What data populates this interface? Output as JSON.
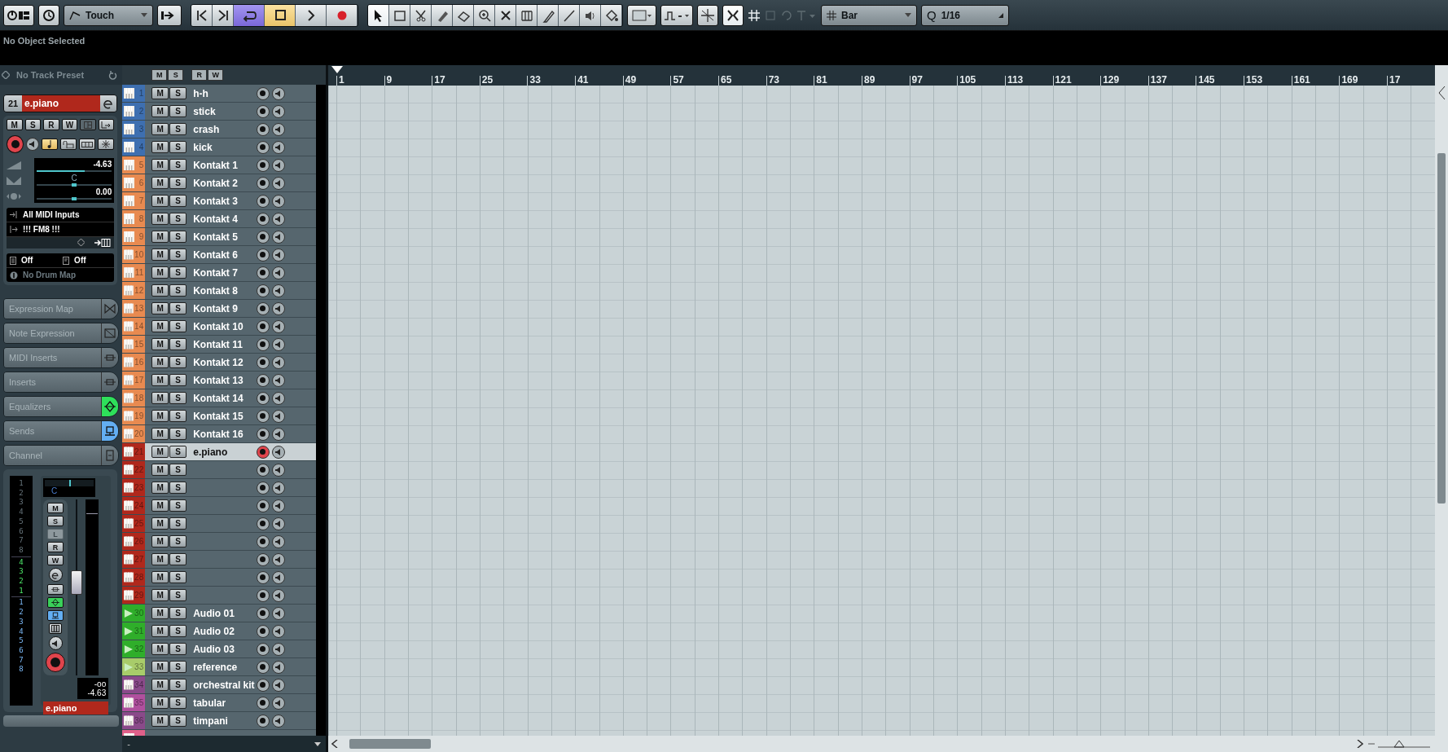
{
  "toolbar": {
    "automation_mode": "Touch",
    "transport": [
      {
        "kind": "to-start",
        "on": false
      },
      {
        "kind": "to-end",
        "on": false
      },
      {
        "kind": "cycle",
        "on": true
      },
      {
        "kind": "stop",
        "on": true
      },
      {
        "kind": "play",
        "on": false
      },
      {
        "kind": "record",
        "on": false
      }
    ],
    "tools": [
      {
        "kind": "pointer",
        "selected": true
      },
      {
        "kind": "range",
        "selected": false
      },
      {
        "kind": "split",
        "selected": false
      },
      {
        "kind": "glue",
        "selected": false
      },
      {
        "kind": "erase",
        "selected": false
      },
      {
        "kind": "zoom",
        "selected": false
      },
      {
        "kind": "mute",
        "selected": false
      },
      {
        "kind": "warp",
        "selected": false
      },
      {
        "kind": "draw",
        "selected": false
      },
      {
        "kind": "line",
        "selected": false
      },
      {
        "kind": "play",
        "selected": false
      },
      {
        "kind": "color",
        "selected": false
      }
    ],
    "snap_on": true,
    "snap_type": "Bar",
    "quantize_icon": "Q",
    "quantize": "1/16"
  },
  "info_line": "No Object Selected",
  "inspector": {
    "preset": "No Track Preset",
    "track_number": "21",
    "track_name": "e.piano",
    "buttons": [
      "M",
      "S",
      "R",
      "W"
    ],
    "record": true,
    "note_edit": true,
    "volume": {
      "reading": "-4.63",
      "level": 0.64
    },
    "pan": {
      "reading": "C",
      "level": 0.5
    },
    "delay": {
      "reading": "0.00",
      "level": 0.5
    },
    "input": "All MIDI Inputs",
    "output": "!!! FM8 !!!",
    "bank": "Off",
    "program": "Off",
    "drum_map": "No Drum Map",
    "sections": [
      {
        "label": "Expression Map",
        "kind": "expression",
        "on": false
      },
      {
        "label": "Note Expression",
        "kind": "note-expression",
        "on": false
      },
      {
        "label": "MIDI Inserts",
        "kind": "insert",
        "on": false
      },
      {
        "label": "Inserts",
        "kind": "insert",
        "on": false
      },
      {
        "label": "Equalizers",
        "kind": "eq",
        "on": true
      },
      {
        "label": "Sends",
        "kind": "send",
        "on": true
      },
      {
        "label": "Channel",
        "kind": "channel",
        "on": false
      }
    ],
    "channel": {
      "meter_scale": [
        {
          "kind": "unused",
          "labels": [
            "1",
            "2",
            "3",
            "4",
            "5",
            "6",
            "7",
            "8"
          ]
        },
        {
          "kind": "input",
          "labels": [
            "4",
            "3",
            "2",
            "1"
          ]
        },
        {
          "kind": "output",
          "labels": [
            "1",
            "2",
            "3",
            "4",
            "5",
            "6",
            "7",
            "8"
          ]
        }
      ],
      "pan": {
        "reading": "C",
        "level": 0.5
      },
      "buttons": [
        {
          "label": "M",
          "disabled": false
        },
        {
          "label": "S",
          "disabled": false
        },
        {
          "label": "L",
          "disabled": true
        },
        {
          "label": "R",
          "disabled": false
        },
        {
          "label": "W",
          "disabled": false
        }
      ],
      "icon_buttons": [
        {
          "kind": "edit",
          "on": false
        },
        {
          "kind": "insert",
          "on": false
        },
        {
          "kind": "eq",
          "on": true
        },
        {
          "kind": "send",
          "on": true
        },
        {
          "kind": "keyboard",
          "on": false
        },
        {
          "kind": "monitor",
          "on": false
        },
        {
          "kind": "record",
          "on": true
        }
      ],
      "fader": {
        "level": 0.55
      },
      "peak": "-oo",
      "volume": "-4.63",
      "name": "e.piano"
    }
  },
  "track_header_buttons": [
    "M",
    "S",
    "R",
    "W"
  ],
  "tracks": [
    {
      "number": "1",
      "name": "h-h",
      "kind": "midi",
      "color": "#3e6fb0",
      "m": "M",
      "s": "S",
      "selected": false,
      "record": false
    },
    {
      "number": "2",
      "name": "stick",
      "kind": "midi",
      "color": "#3e6fb0",
      "m": "M",
      "s": "S",
      "selected": false,
      "record": false
    },
    {
      "number": "3",
      "name": "crash",
      "kind": "midi",
      "color": "#3e6fb0",
      "m": "M",
      "s": "S",
      "selected": false,
      "record": false
    },
    {
      "number": "4",
      "name": "kick",
      "kind": "midi",
      "color": "#3e6fb0",
      "m": "M",
      "s": "S",
      "selected": false,
      "record": false
    },
    {
      "number": "5",
      "name": "Kontakt 1",
      "kind": "midi",
      "color": "#e88a50",
      "m": "M",
      "s": "S",
      "selected": false,
      "record": false
    },
    {
      "number": "6",
      "name": "Kontakt 2",
      "kind": "midi",
      "color": "#e88a50",
      "m": "M",
      "s": "S",
      "selected": false,
      "record": false
    },
    {
      "number": "7",
      "name": "Kontakt 3",
      "kind": "midi",
      "color": "#e88a50",
      "m": "M",
      "s": "S",
      "selected": false,
      "record": false
    },
    {
      "number": "8",
      "name": "Kontakt 4",
      "kind": "midi",
      "color": "#e88a50",
      "m": "M",
      "s": "S",
      "selected": false,
      "record": false
    },
    {
      "number": "9",
      "name": "Kontakt 5",
      "kind": "midi",
      "color": "#e88a50",
      "m": "M",
      "s": "S",
      "selected": false,
      "record": false
    },
    {
      "number": "10",
      "name": "Kontakt 6",
      "kind": "midi",
      "color": "#e88a50",
      "m": "M",
      "s": "S",
      "selected": false,
      "record": false
    },
    {
      "number": "11",
      "name": "Kontakt 7",
      "kind": "midi",
      "color": "#e88a50",
      "m": "M",
      "s": "S",
      "selected": false,
      "record": false
    },
    {
      "number": "12",
      "name": "Kontakt 8",
      "kind": "midi",
      "color": "#e88a50",
      "m": "M",
      "s": "S",
      "selected": false,
      "record": false
    },
    {
      "number": "13",
      "name": "Kontakt 9",
      "kind": "midi",
      "color": "#e88a50",
      "m": "M",
      "s": "S",
      "selected": false,
      "record": false
    },
    {
      "number": "14",
      "name": "Kontakt 10",
      "kind": "midi",
      "color": "#e88a50",
      "m": "M",
      "s": "S",
      "selected": false,
      "record": false
    },
    {
      "number": "15",
      "name": "Kontakt 11",
      "kind": "midi",
      "color": "#e88a50",
      "m": "M",
      "s": "S",
      "selected": false,
      "record": false
    },
    {
      "number": "16",
      "name": "Kontakt 12",
      "kind": "midi",
      "color": "#e88a50",
      "m": "M",
      "s": "S",
      "selected": false,
      "record": false
    },
    {
      "number": "17",
      "name": "Kontakt 13",
      "kind": "midi",
      "color": "#e88a50",
      "m": "M",
      "s": "S",
      "selected": false,
      "record": false
    },
    {
      "number": "18",
      "name": "Kontakt 14",
      "kind": "midi",
      "color": "#e88a50",
      "m": "M",
      "s": "S",
      "selected": false,
      "record": false
    },
    {
      "number": "19",
      "name": "Kontakt 15",
      "kind": "midi",
      "color": "#e88a50",
      "m": "M",
      "s": "S",
      "selected": false,
      "record": false
    },
    {
      "number": "20",
      "name": "Kontakt 16",
      "kind": "midi",
      "color": "#e88a50",
      "m": "M",
      "s": "S",
      "selected": false,
      "record": false
    },
    {
      "number": "21",
      "name": "e.piano",
      "kind": "midi",
      "color": "#b0281c",
      "m": "M",
      "s": "S",
      "selected": true,
      "record": true
    },
    {
      "number": "22",
      "kind": "midi",
      "color": "#b0281c",
      "m": "M",
      "s": "S",
      "selected": false,
      "record": false
    },
    {
      "number": "23",
      "kind": "midi",
      "color": "#b0281c",
      "m": "M",
      "s": "S",
      "selected": false,
      "record": false
    },
    {
      "number": "24",
      "kind": "midi",
      "color": "#b0281c",
      "m": "M",
      "s": "S",
      "selected": false,
      "record": false
    },
    {
      "number": "25",
      "kind": "midi",
      "color": "#b0281c",
      "m": "M",
      "s": "S",
      "selected": false,
      "record": false
    },
    {
      "number": "26",
      "kind": "midi",
      "color": "#b0281c",
      "m": "M",
      "s": "S",
      "selected": false,
      "record": false
    },
    {
      "number": "27",
      "kind": "midi",
      "color": "#b0281c",
      "m": "M",
      "s": "S",
      "selected": false,
      "record": false
    },
    {
      "number": "28",
      "kind": "midi",
      "color": "#b0281c",
      "m": "M",
      "s": "S",
      "selected": false,
      "record": false
    },
    {
      "number": "29",
      "kind": "midi",
      "color": "#b0281c",
      "m": "M",
      "s": "S",
      "selected": false,
      "record": false
    },
    {
      "number": "30",
      "name": "Audio 01",
      "kind": "audio",
      "color": "#2fae2a",
      "m": "M",
      "s": "S",
      "selected": false,
      "record": false
    },
    {
      "number": "31",
      "name": "Audio 02",
      "kind": "audio",
      "color": "#2fae2a",
      "m": "M",
      "s": "S",
      "selected": false,
      "record": false
    },
    {
      "number": "32",
      "name": "Audio 03",
      "kind": "audio",
      "color": "#2fae2a",
      "m": "M",
      "s": "S",
      "selected": false,
      "record": false
    },
    {
      "number": "33",
      "name": "reference",
      "kind": "audio",
      "color": "#a8cc6a",
      "m": "M",
      "s": "S",
      "selected": false,
      "record": false
    },
    {
      "number": "34",
      "name": "orchestral kit",
      "kind": "midi",
      "color": "#8a4a8a",
      "m": "M",
      "s": "S",
      "selected": false,
      "record": false
    },
    {
      "number": "35",
      "name": "tabular",
      "kind": "midi",
      "color": "#b0509e",
      "m": "M",
      "s": "S",
      "selected": false,
      "record": false
    },
    {
      "number": "36",
      "name": "timpani",
      "kind": "midi",
      "color": "#8a4a8a",
      "m": "M",
      "s": "S",
      "selected": false,
      "record": false
    },
    {
      "kind": "midi",
      "color": "#e0608a",
      "selected": false
    }
  ],
  "track_list_footer": "-",
  "ruler": [
    "1",
    "9",
    "17",
    "25",
    "33",
    "41",
    "49",
    "57",
    "65",
    "73",
    "81",
    "89",
    "97",
    "105",
    "113",
    "121",
    "129",
    "137",
    "145",
    "153",
    "161",
    "169",
    "17"
  ]
}
